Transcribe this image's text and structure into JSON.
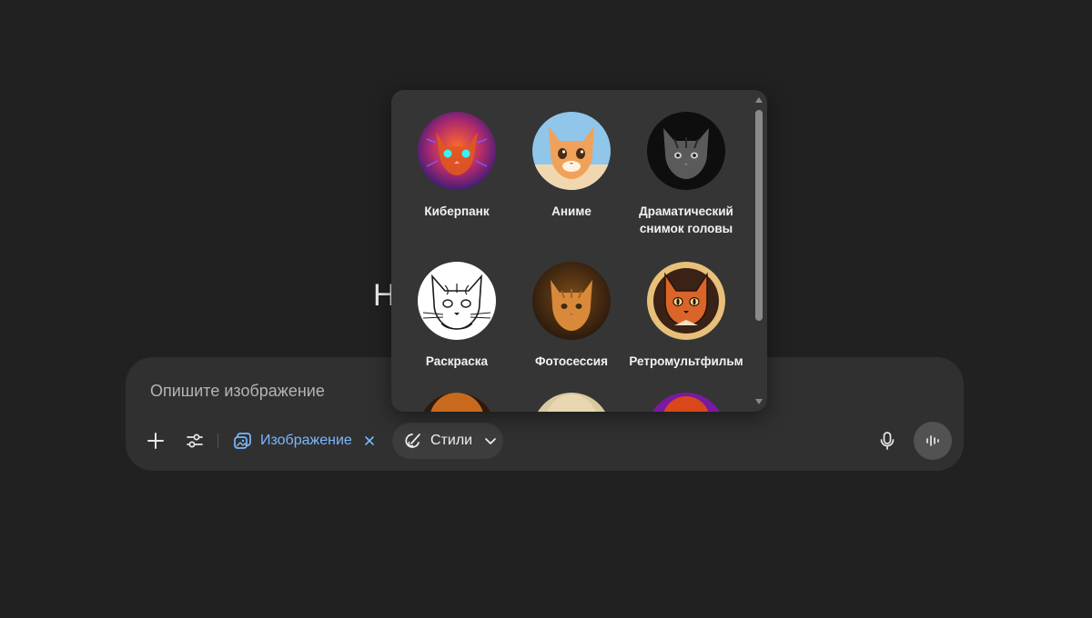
{
  "heading": {
    "text": "Н"
  },
  "composer": {
    "placeholder": "Опишите изображение",
    "add_label": "+",
    "image_chip_label": "Изображение",
    "styles_chip_label": "Стили"
  },
  "styles_menu": {
    "items": [
      {
        "label": "Киберпанк",
        "icon": "cyberpunk-cat"
      },
      {
        "label": "Аниме",
        "icon": "anime-cat"
      },
      {
        "label": "Драматический снимок головы",
        "icon": "dramatic-headshot-cat"
      },
      {
        "label": "Раскраска",
        "icon": "coloring-cat"
      },
      {
        "label": "Фотосессия",
        "icon": "photoshoot-cat"
      },
      {
        "label": "Ретромультфильм",
        "icon": "retro-cartoon-cat"
      }
    ]
  },
  "colors": {
    "background": "#212121",
    "composer": "#303030",
    "popover": "#353535",
    "accent_link": "#7ab7ff"
  }
}
